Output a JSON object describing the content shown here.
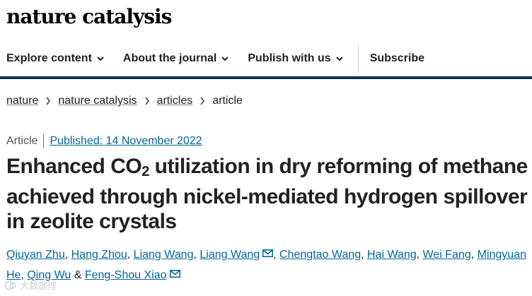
{
  "site": {
    "logo": "nature catalysis"
  },
  "nav": {
    "items": [
      {
        "label": "Explore content"
      },
      {
        "label": "About the journal"
      },
      {
        "label": "Publish with us"
      }
    ],
    "subscribe": "Subscribe"
  },
  "breadcrumb": [
    "nature",
    "nature catalysis",
    "articles",
    "article"
  ],
  "article": {
    "type": "Article",
    "published": "Published: 14 November 2022",
    "title_part1": "Enhanced CO",
    "title_sub": "2",
    "title_part2": " utilization in dry reforming of methane achieved through nickel-mediated hydrogen spillover in zeolite crystals"
  },
  "authors": [
    "Qiuyan Zhu",
    "Hang Zhou",
    "Liang Wang",
    "Liang Wang",
    "Chengtao Wang",
    "Hai Wang",
    "Wei Fang",
    "Mingyuan He",
    "Qing Wu",
    "Feng-Shou Xiao"
  ],
  "author_separators": {
    "comma": ", ",
    "and": " & "
  },
  "watermark": "大数据理"
}
